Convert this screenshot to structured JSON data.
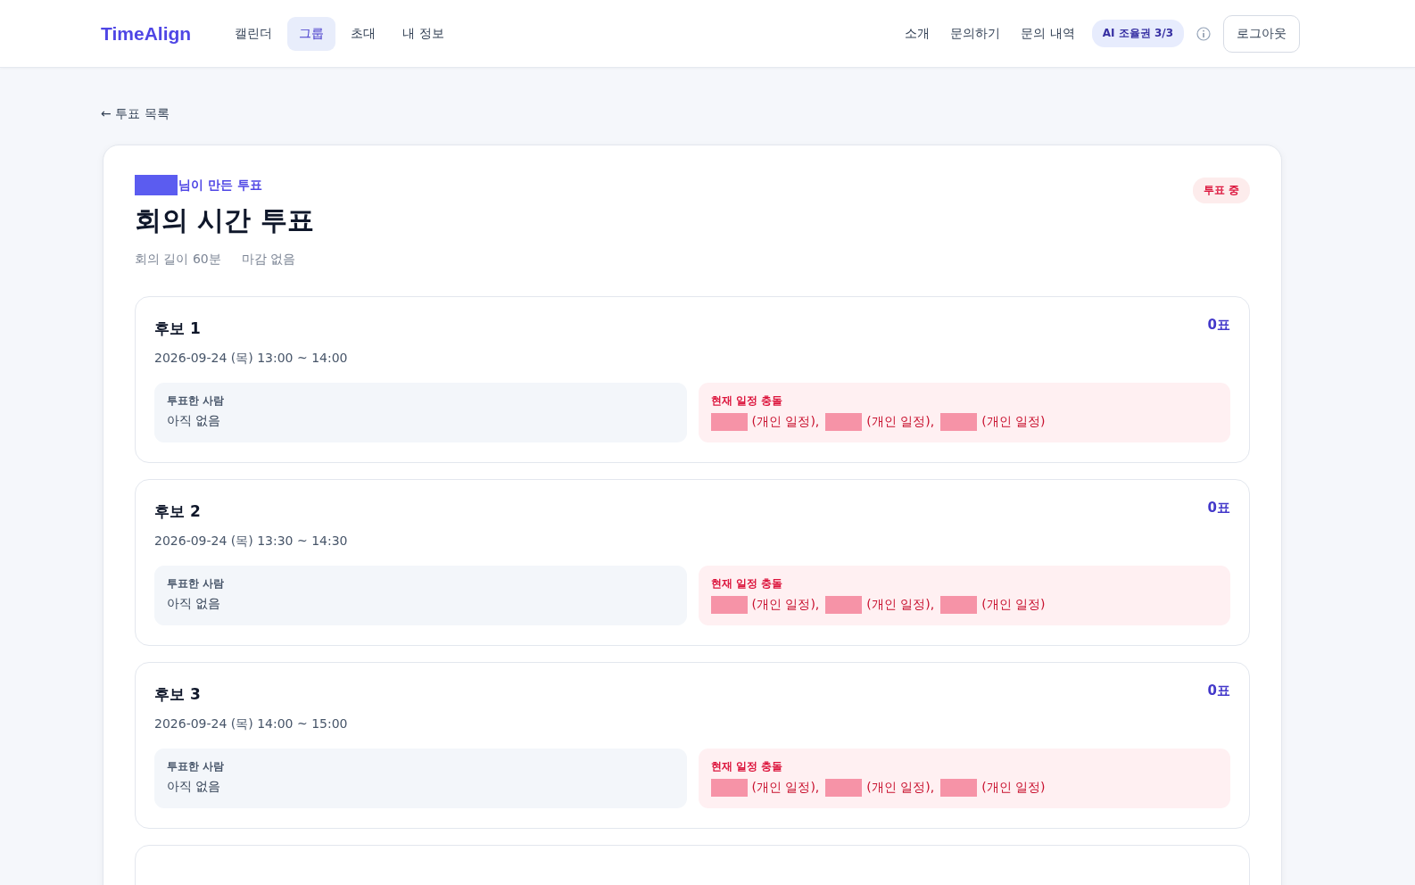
{
  "header": {
    "logo": "TimeAlign",
    "nav": [
      {
        "label": "캘린더",
        "selected": false
      },
      {
        "label": "그룹",
        "selected": true
      },
      {
        "label": "초대",
        "selected": false
      },
      {
        "label": "내 정보",
        "selected": false
      }
    ],
    "links": [
      "소개",
      "문의하기",
      "문의 내역"
    ],
    "ai_badge": "AI 조율권 3/3",
    "logout": "로그아웃"
  },
  "back_link": "← 투표 목록",
  "poll": {
    "creator_suffix": "님이 만든 투표",
    "status": "투표 중",
    "title": "회의 시간 투표",
    "meta": [
      "회의 길이 60분",
      "마감 없음"
    ],
    "candidates": [
      {
        "title": "후보 1",
        "votes": "0표",
        "time": "2026-09-24 (목) 13:00 ~ 14:00",
        "voters_label": "투표한 사람",
        "voters": "아직 없음",
        "conflict_label": "현재 일정 충돌",
        "conflicts": [
          "(개인 일정),",
          "(개인 일정),",
          "(개인 일정)"
        ]
      },
      {
        "title": "후보 2",
        "votes": "0표",
        "time": "2026-09-24 (목) 13:30 ~ 14:30",
        "voters_label": "투표한 사람",
        "voters": "아직 없음",
        "conflict_label": "현재 일정 충돌",
        "conflicts": [
          "(개인 일정),",
          "(개인 일정),",
          "(개인 일정)"
        ]
      },
      {
        "title": "후보 3",
        "votes": "0표",
        "time": "2026-09-24 (목) 14:00 ~ 15:00",
        "voters_label": "투표한 사람",
        "voters": "아직 없음",
        "conflict_label": "현재 일정 충돌",
        "conflicts": [
          "(개인 일정),",
          "(개인 일정),",
          "(개인 일정)"
        ]
      }
    ]
  }
}
